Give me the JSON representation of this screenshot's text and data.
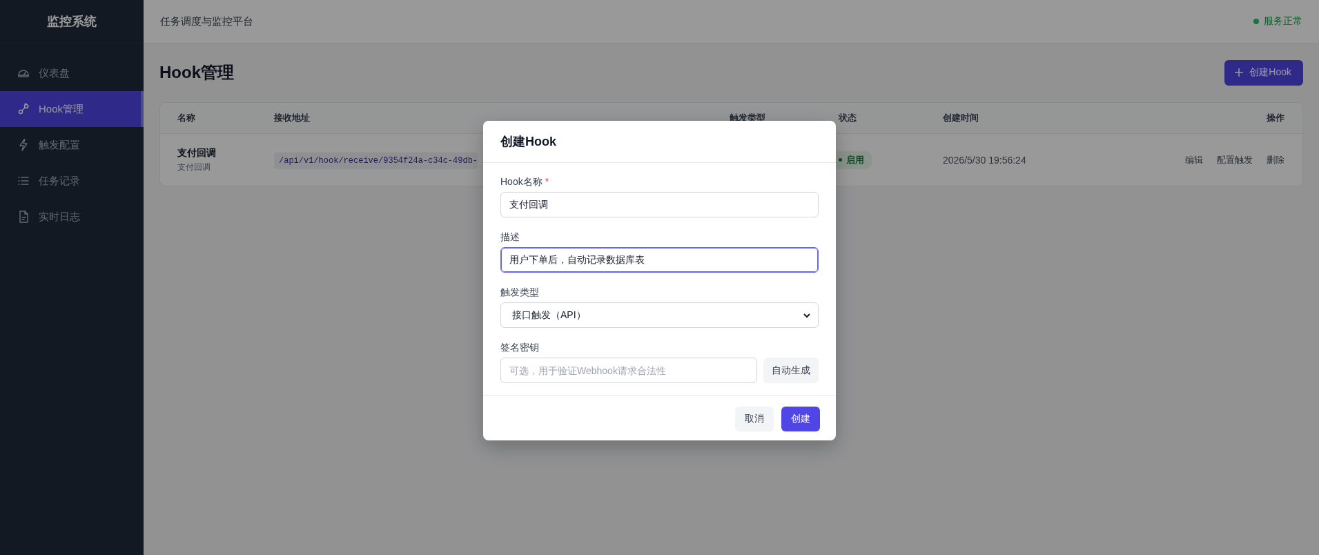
{
  "sidebar": {
    "brand": "监控系统",
    "items": [
      {
        "label": "仪表盘",
        "selected": false
      },
      {
        "label": "Hook管理",
        "selected": true
      },
      {
        "label": "触发配置",
        "selected": false
      },
      {
        "label": "任务记录",
        "selected": false
      },
      {
        "label": "实时日志",
        "selected": false
      }
    ]
  },
  "header": {
    "title": "任务调度与监控平台",
    "status": "服务正常"
  },
  "page": {
    "title": "Hook管理",
    "create_button": "创建Hook"
  },
  "table": {
    "columns": [
      "名称",
      "接收地址",
      "触发类型",
      "状态",
      "创建时间",
      "操作"
    ],
    "rows": [
      {
        "name": "支付回调",
        "subtitle": "支付回调",
        "address": "/api/v1/hook/receive/9354f24a-c34c-49db-",
        "status": {
          "label": "启用",
          "enabled": true
        },
        "created": "2026/5/30 19:56:24",
        "actions": [
          "编辑",
          "配置触发",
          "删除"
        ]
      }
    ]
  },
  "modal": {
    "title": "创建Hook",
    "fields": [
      {
        "kind": "text",
        "label": "Hook名称",
        "required_mark": "*",
        "value": "支付回调",
        "focused": false
      },
      {
        "kind": "text",
        "label": "描述",
        "value": "用户下单后，自动记录数据库表",
        "focused": true
      },
      {
        "kind": "select",
        "label": "触发类型",
        "value": "接口触发（API）"
      },
      {
        "kind": "secret",
        "label": "签名密钥",
        "placeholder": "可选，用于验证Webhook请求合法性",
        "button": "自动生成"
      }
    ],
    "buttons": [
      {
        "label": "取消",
        "kind": "secondary"
      },
      {
        "label": "创建",
        "kind": "primary"
      }
    ]
  }
}
